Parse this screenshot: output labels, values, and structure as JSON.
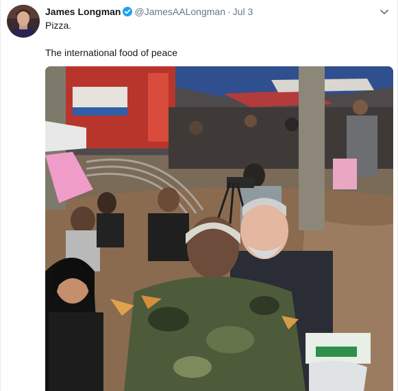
{
  "tweet": {
    "author_name": "James Longman",
    "handle": "@JamesAALongman",
    "separator": "·",
    "date": "Jul 3",
    "text_line1": "Pizza.",
    "text_line2": "The international food of peace",
    "verified": true
  },
  "icons": {
    "avatar": "profile-photo",
    "verified": "verified-badge-icon",
    "menu": "chevron-down-icon"
  },
  "colors": {
    "name": "#14171a",
    "secondary": "#657786",
    "verified": "#1da1f2"
  }
}
